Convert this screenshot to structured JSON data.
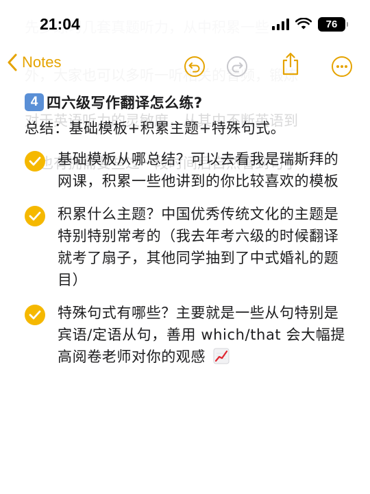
{
  "status_bar": {
    "time": "21:04",
    "battery": "76",
    "icons": [
      "signal-icon",
      "wifi-icon",
      "battery-icon"
    ]
  },
  "background_text": [
    "先多练习几套真题听力，从中积累一些",
    "外，大家也可以多听一听相关的音频，锻炼",
    "对于英语听力的灵敏度，从其中不断英语到",
    "也也有拥需要些过一段时间后自然看到句子"
  ],
  "nav": {
    "back_label": "Notes",
    "accent_color": "#e5a300",
    "buttons": [
      "undo-icon",
      "redo-icon",
      "share-icon",
      "more-icon"
    ]
  },
  "note": {
    "heading_number": "4",
    "heading": "四六级写作翻译怎么练?",
    "summary": "总结：基础模板+积累主题+特殊句式。",
    "items": [
      "基础模板从哪总结？可以去看我是瑞斯拜的网课，积累一些他讲到的你比较喜欢的模板",
      "积累什么主题？中国优秀传统文化的主题是特别特别常考的（我去年考六级的时候翻译就考了扇子，其他同学抽到了中式婚礼的题目）",
      "特殊句式有哪些？主要就是一些从句特别是宾语/定语从句，善用 which/that 会大幅提高阅卷老师对你的观感"
    ],
    "check_color": "#f5b800",
    "trailing_emoji": "chart-increasing-icon"
  }
}
